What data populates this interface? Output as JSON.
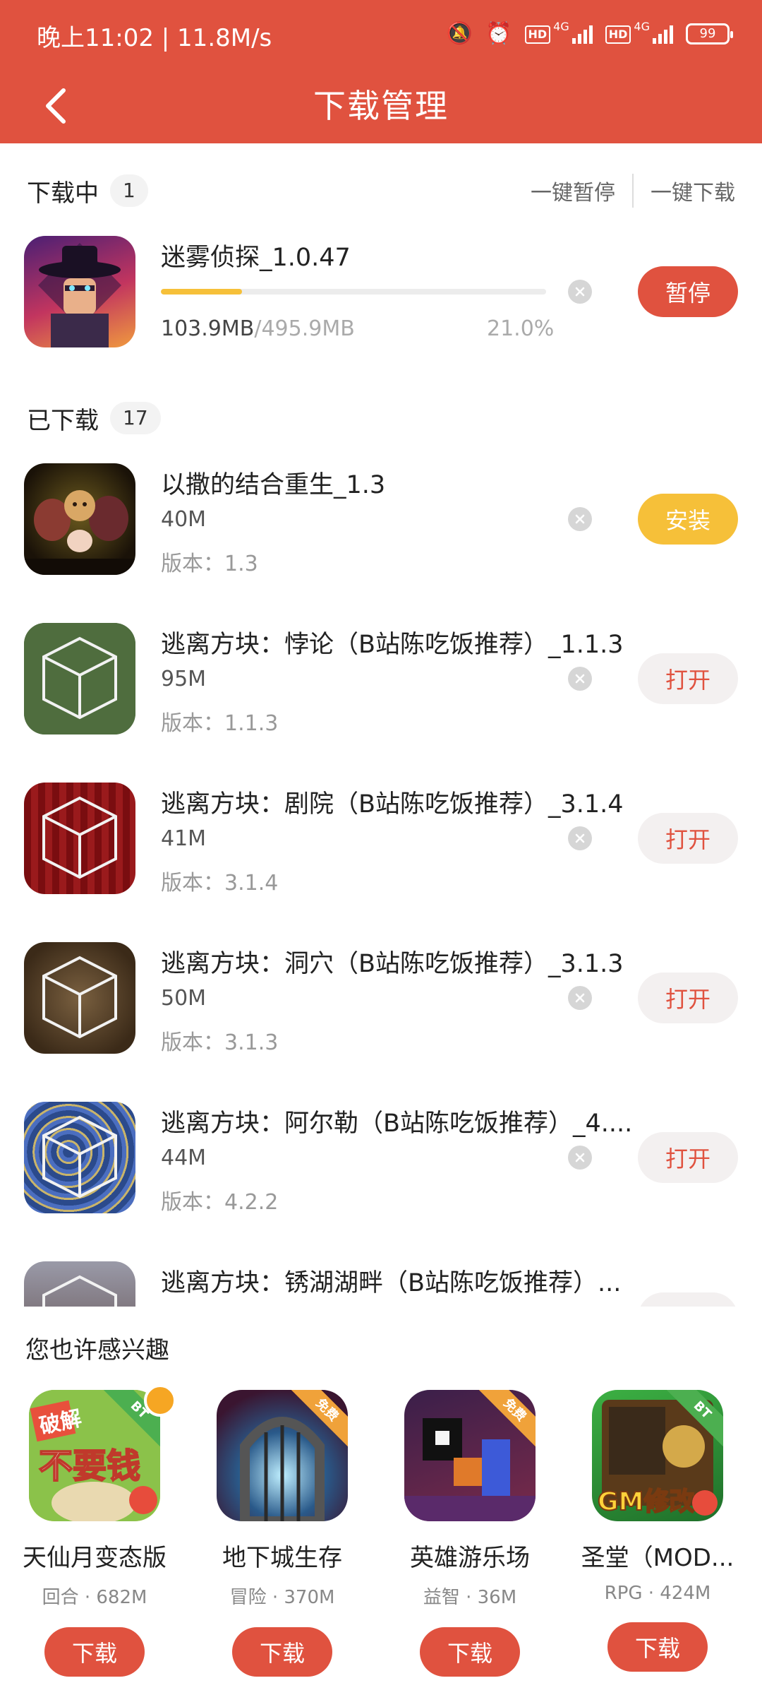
{
  "status_bar": {
    "time_speed": "晚上11:02 | 11.8M/s",
    "battery": "99",
    "network_1": "4G",
    "network_2": "4G",
    "hd_1": "HD",
    "hd_2": "HD"
  },
  "header": {
    "title": "下载管理"
  },
  "downloading": {
    "label": "下载中",
    "count": "1",
    "pause_all": "一键暂停",
    "download_all": "一键下载",
    "items": [
      {
        "name": "迷雾侦探_1.0.47",
        "downloaded": "103.9MB",
        "total": "/495.9MB",
        "percent_text": "21.0%",
        "progress": 0.21,
        "action": "暂停"
      }
    ]
  },
  "downloaded": {
    "label": "已下载",
    "count": "17",
    "items": [
      {
        "name": "以撒的结合重生_1.3",
        "size": "40M",
        "version": "版本：1.3",
        "action": "安装"
      },
      {
        "name": "逃离方块：悖论（B站陈吃饭推荐）_1.1.3",
        "size": "95M",
        "version": "版本：1.1.3",
        "action": "打开"
      },
      {
        "name": "逃离方块：剧院（B站陈吃饭推荐）_3.1.4",
        "size": "41M",
        "version": "版本：3.1.4",
        "action": "打开"
      },
      {
        "name": "逃离方块：洞穴（B站陈吃饭推荐）_3.1.3",
        "size": "50M",
        "version": "版本：3.1.3",
        "action": "打开"
      },
      {
        "name": "逃离方块：阿尔勒（B站陈吃饭推荐）_4....",
        "size": "44M",
        "version": "版本：4.2.2",
        "action": "打开"
      },
      {
        "name": "逃离方块：锈湖湖畔（B站陈吃饭推荐）..."
      }
    ]
  },
  "recommend": {
    "title": "您也许感兴趣",
    "items": [
      {
        "name": "天仙月变态版",
        "meta": "回合 · 682M",
        "button": "下载",
        "badge": "BT",
        "icon_text": "不要钱",
        "icon_sub": "破解"
      },
      {
        "name": "地下城生存",
        "meta": "冒险 · 370M",
        "button": "下载",
        "badge": "免费"
      },
      {
        "name": "英雄游乐场",
        "meta": "益智 · 36M",
        "button": "下载",
        "badge": "免费"
      },
      {
        "name": "圣堂（MOD...",
        "meta": "RPG · 424M",
        "button": "下载",
        "badge": "BT",
        "icon_text": "GM修改"
      }
    ]
  },
  "colors": {
    "primary": "#e0523f",
    "install_yellow": "#f6c039",
    "progress": "#f6c039"
  }
}
